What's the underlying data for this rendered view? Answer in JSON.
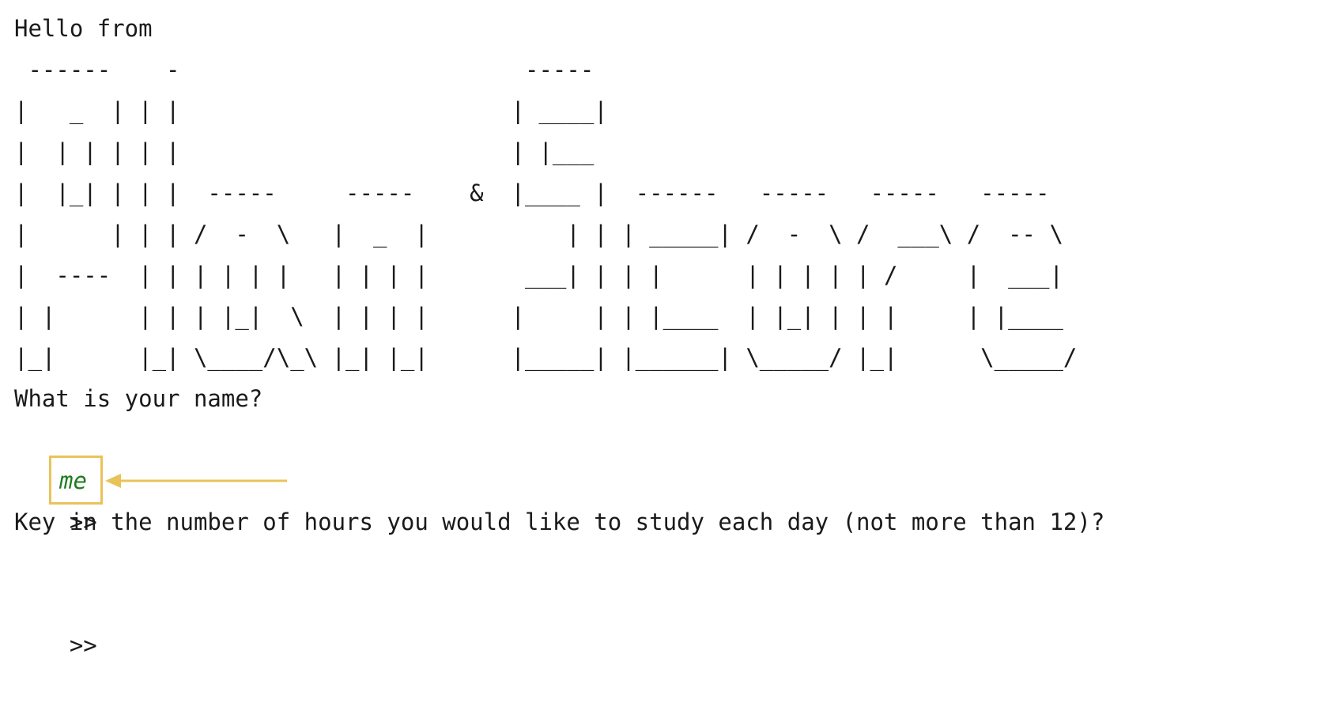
{
  "terminal": {
    "greeting": "Hello from",
    "banner_art": " ------    -                         -----\n|   _  | | |                        | ____|\n|  | | | | |                        | |___\n|  |_| | | |  -----     -----    &  |____ |  ------   -----   -----   -----\n|      | | | /  -  \\   |  _  |          | | | _____| /  -  \\ /  ___\\ /  -- \\\n|  ----  | | | | | |   | | | |       ___| | | |      | | | | | /     |  ___|\n| |      | | | |_|  \\  | | | |      |     | | |____  | |_| | | |     | |____\n|_|      |_| \\____/\\_\\ |_| |_|      |_____| |______| \\_____/ |_|      \\_____/",
    "name_question": "What is your name?",
    "prompt_symbol": ">>",
    "name_input_value": "me",
    "hours_question": "Key in the number of hours you would like to study each day (not more than 12)?",
    "prompt_symbol_2": ">>"
  },
  "colors": {
    "highlight": "#e9c35a",
    "input_text": "#1e7d1e",
    "text": "#1a1a1a"
  }
}
